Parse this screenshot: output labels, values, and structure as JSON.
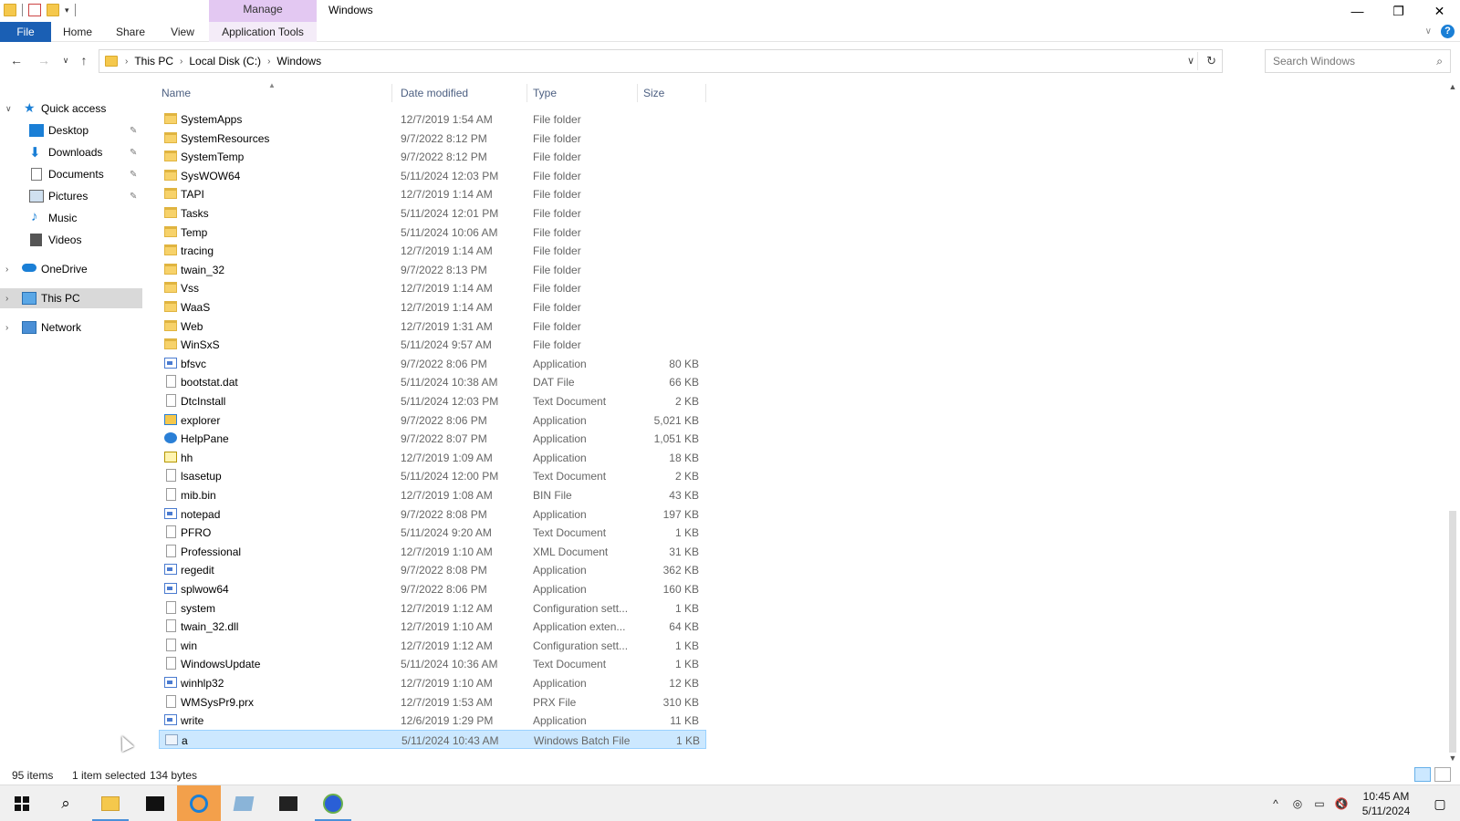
{
  "titlebar": {
    "manage_tab": "Manage",
    "title": "Windows",
    "minimize": "—",
    "restore": "❐",
    "close": "✕"
  },
  "ribbon": {
    "tabs": [
      "File",
      "Home",
      "Share",
      "View",
      "Application Tools"
    ],
    "help": "?"
  },
  "address": {
    "breadcrumb": [
      "This PC",
      "Local Disk (C:)",
      "Windows"
    ],
    "search_placeholder": "Search Windows"
  },
  "nav": {
    "quick_access": "Quick access",
    "items": [
      {
        "label": "Desktop",
        "pinned": true
      },
      {
        "label": "Downloads",
        "pinned": true
      },
      {
        "label": "Documents",
        "pinned": true
      },
      {
        "label": "Pictures",
        "pinned": true
      },
      {
        "label": "Music",
        "pinned": false
      },
      {
        "label": "Videos",
        "pinned": false
      }
    ],
    "onedrive": "OneDrive",
    "this_pc": "This PC",
    "network": "Network"
  },
  "columns": {
    "name": "Name",
    "date": "Date modified",
    "type": "Type",
    "size": "Size"
  },
  "files": [
    {
      "name": "SystemApps",
      "date": "12/7/2019 1:54 AM",
      "type": "File folder",
      "size": "",
      "icon": "folder"
    },
    {
      "name": "SystemResources",
      "date": "9/7/2022 8:12 PM",
      "type": "File folder",
      "size": "",
      "icon": "folder"
    },
    {
      "name": "SystemTemp",
      "date": "9/7/2022 8:12 PM",
      "type": "File folder",
      "size": "",
      "icon": "folder"
    },
    {
      "name": "SysWOW64",
      "date": "5/11/2024 12:03 PM",
      "type": "File folder",
      "size": "",
      "icon": "folder"
    },
    {
      "name": "TAPI",
      "date": "12/7/2019 1:14 AM",
      "type": "File folder",
      "size": "",
      "icon": "folder"
    },
    {
      "name": "Tasks",
      "date": "5/11/2024 12:01 PM",
      "type": "File folder",
      "size": "",
      "icon": "folder"
    },
    {
      "name": "Temp",
      "date": "5/11/2024 10:06 AM",
      "type": "File folder",
      "size": "",
      "icon": "folder"
    },
    {
      "name": "tracing",
      "date": "12/7/2019 1:14 AM",
      "type": "File folder",
      "size": "",
      "icon": "folder"
    },
    {
      "name": "twain_32",
      "date": "9/7/2022 8:13 PM",
      "type": "File folder",
      "size": "",
      "icon": "folder"
    },
    {
      "name": "Vss",
      "date": "12/7/2019 1:14 AM",
      "type": "File folder",
      "size": "",
      "icon": "folder"
    },
    {
      "name": "WaaS",
      "date": "12/7/2019 1:14 AM",
      "type": "File folder",
      "size": "",
      "icon": "folder"
    },
    {
      "name": "Web",
      "date": "12/7/2019 1:31 AM",
      "type": "File folder",
      "size": "",
      "icon": "folder"
    },
    {
      "name": "WinSxS",
      "date": "5/11/2024 9:57 AM",
      "type": "File folder",
      "size": "",
      "icon": "folder"
    },
    {
      "name": "bfsvc",
      "date": "9/7/2022 8:06 PM",
      "type": "Application",
      "size": "80 KB",
      "icon": "app"
    },
    {
      "name": "bootstat.dat",
      "date": "5/11/2024 10:38 AM",
      "type": "DAT File",
      "size": "66 KB",
      "icon": "doc"
    },
    {
      "name": "DtcInstall",
      "date": "5/11/2024 12:03 PM",
      "type": "Text Document",
      "size": "2 KB",
      "icon": "doc"
    },
    {
      "name": "explorer",
      "date": "9/7/2022 8:06 PM",
      "type": "Application",
      "size": "5,021 KB",
      "icon": "explorer"
    },
    {
      "name": "HelpPane",
      "date": "9/7/2022 8:07 PM",
      "type": "Application",
      "size": "1,051 KB",
      "icon": "help"
    },
    {
      "name": "hh",
      "date": "12/7/2019 1:09 AM",
      "type": "Application",
      "size": "18 KB",
      "icon": "hh"
    },
    {
      "name": "lsasetup",
      "date": "5/11/2024 12:00 PM",
      "type": "Text Document",
      "size": "2 KB",
      "icon": "doc"
    },
    {
      "name": "mib.bin",
      "date": "12/7/2019 1:08 AM",
      "type": "BIN File",
      "size": "43 KB",
      "icon": "doc"
    },
    {
      "name": "notepad",
      "date": "9/7/2022 8:08 PM",
      "type": "Application",
      "size": "197 KB",
      "icon": "app"
    },
    {
      "name": "PFRO",
      "date": "5/11/2024 9:20 AM",
      "type": "Text Document",
      "size": "1 KB",
      "icon": "doc"
    },
    {
      "name": "Professional",
      "date": "12/7/2019 1:10 AM",
      "type": "XML Document",
      "size": "31 KB",
      "icon": "doc"
    },
    {
      "name": "regedit",
      "date": "9/7/2022 8:08 PM",
      "type": "Application",
      "size": "362 KB",
      "icon": "app"
    },
    {
      "name": "splwow64",
      "date": "9/7/2022 8:06 PM",
      "type": "Application",
      "size": "160 KB",
      "icon": "app"
    },
    {
      "name": "system",
      "date": "12/7/2019 1:12 AM",
      "type": "Configuration sett...",
      "size": "1 KB",
      "icon": "doc"
    },
    {
      "name": "twain_32.dll",
      "date": "12/7/2019 1:10 AM",
      "type": "Application exten...",
      "size": "64 KB",
      "icon": "doc"
    },
    {
      "name": "win",
      "date": "12/7/2019 1:12 AM",
      "type": "Configuration sett...",
      "size": "1 KB",
      "icon": "doc"
    },
    {
      "name": "WindowsUpdate",
      "date": "5/11/2024 10:36 AM",
      "type": "Text Document",
      "size": "1 KB",
      "icon": "doc"
    },
    {
      "name": "winhlp32",
      "date": "12/7/2019 1:10 AM",
      "type": "Application",
      "size": "12 KB",
      "icon": "app"
    },
    {
      "name": "WMSysPr9.prx",
      "date": "12/7/2019 1:53 AM",
      "type": "PRX File",
      "size": "310 KB",
      "icon": "doc"
    },
    {
      "name": "write",
      "date": "12/6/2019 1:29 PM",
      "type": "Application",
      "size": "11 KB",
      "icon": "app"
    },
    {
      "name": "a",
      "date": "5/11/2024 10:43 AM",
      "type": "Windows Batch File",
      "size": "1 KB",
      "icon": "bat",
      "selected": true
    }
  ],
  "status": {
    "count": "95 items",
    "selected": "1 item selected",
    "bytes": "134 bytes"
  },
  "taskbar": {
    "time": "10:45 AM",
    "date": "5/11/2024"
  },
  "colors": {
    "file_tab": "#1a5fb4",
    "manage_tab": "#e3c8f2",
    "selection": "#cce8ff"
  }
}
